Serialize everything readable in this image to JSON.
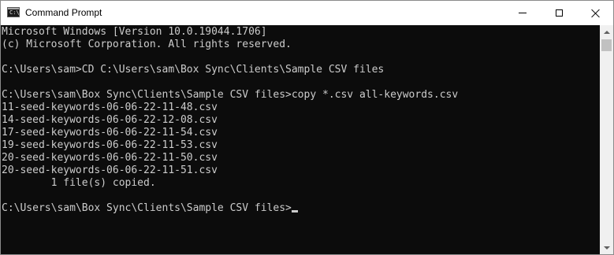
{
  "window": {
    "title": "Command Prompt",
    "icon": "cmd-icon",
    "icon_glyph": "C:\\"
  },
  "controls": {
    "minimize_icon": "minimize-icon",
    "maximize_icon": "maximize-icon",
    "close_icon": "close-icon"
  },
  "console": {
    "lines": [
      "Microsoft Windows [Version 10.0.19044.1706]",
      "(c) Microsoft Corporation. All rights reserved.",
      "",
      "C:\\Users\\sam>CD C:\\Users\\sam\\Box Sync\\Clients\\Sample CSV files",
      "",
      "C:\\Users\\sam\\Box Sync\\Clients\\Sample CSV files>copy *.csv all-keywords.csv",
      "11-seed-keywords-06-06-22-11-48.csv",
      "14-seed-keywords-06-06-22-12-08.csv",
      "17-seed-keywords-06-06-22-11-54.csv",
      "19-seed-keywords-06-06-22-11-53.csv",
      "20-seed-keywords-06-06-22-11-50.csv",
      "20-seed-keywords-06-06-22-11-51.csv",
      "        1 file(s) copied.",
      "",
      "C:\\Users\\sam\\Box Sync\\Clients\\Sample CSV files>"
    ]
  },
  "colors": {
    "console_background": "#0c0c0c",
    "console_text": "#cccccc",
    "titlebar_background": "#ffffff"
  }
}
